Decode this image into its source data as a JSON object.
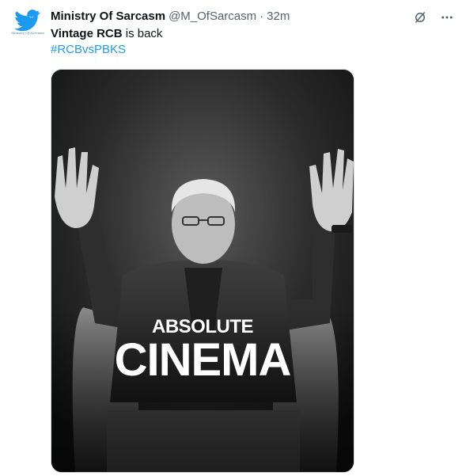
{
  "tweet": {
    "author": {
      "display_name": "Ministry Of Sarcasm",
      "handle": "@M_OfSarcasm",
      "avatar_icon": "bird-logo-icon",
      "avatar_caption": "Ministry Of Sarcasm"
    },
    "separator": "·",
    "time": "32m",
    "text": {
      "bold_part": "Vintage RCB",
      "rest": " is back"
    },
    "hashtag": "#RCBvsPBKS",
    "media": {
      "caption_top": "ABSOLUTE",
      "caption_bottom": "CINEMA"
    },
    "actions": {
      "grok_icon": "grok-icon",
      "more_icon": "more-icon"
    }
  },
  "colors": {
    "link": "#1d9bf0",
    "secondary_text": "#536471",
    "primary_text": "#0f1419",
    "avatar_blue": "#1d9bf0"
  }
}
